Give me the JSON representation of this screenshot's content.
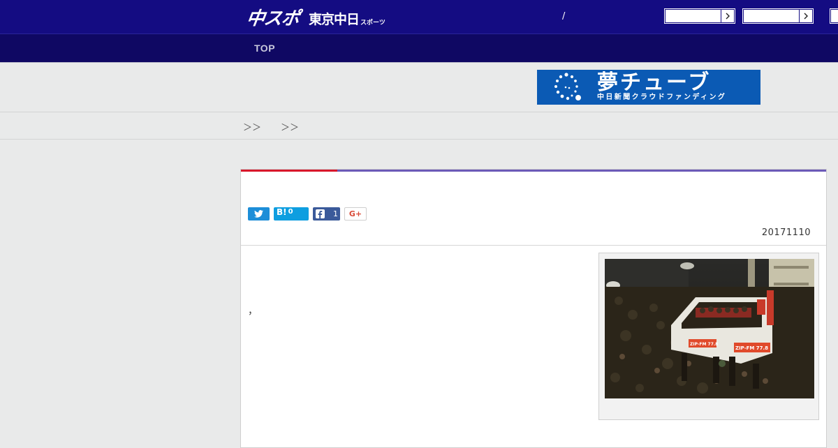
{
  "header": {
    "logo_main": "中スポ",
    "logo_sub": "東京中日",
    "logo_tiny": "スポーツ",
    "separator": "/",
    "buttons": [
      "",
      "",
      ""
    ]
  },
  "nav": {
    "items": [
      "TOP"
    ]
  },
  "banner": {
    "title": "夢チューブ",
    "subtitle": "中日新聞クラウドファンディング"
  },
  "breadcrumb": {
    "separators": [
      "＞＞",
      "＞＞"
    ]
  },
  "article": {
    "share": {
      "hatena_label": "B!",
      "hatena_count": "0",
      "facebook_count": "1",
      "google_label": "G+"
    },
    "date": "20171110",
    "body_text": "，"
  },
  "colors": {
    "header_bg": "#140c82",
    "nav_bg": "#0f0863",
    "banner_bg": "#0b5ab4",
    "accent_red": "#d8172a",
    "accent_purple": "#6b5ab7",
    "twitter": "#1d8ed8",
    "hatena": "#0e9ee0",
    "facebook": "#3b5a9a"
  },
  "icons": {
    "twitter": "twitter-bird-icon",
    "facebook": "facebook-icon",
    "arrow": "chevron-right-icon"
  },
  "image_text": [
    "ZIP-FM 77.8",
    "ZIP-FM 77.8"
  ]
}
